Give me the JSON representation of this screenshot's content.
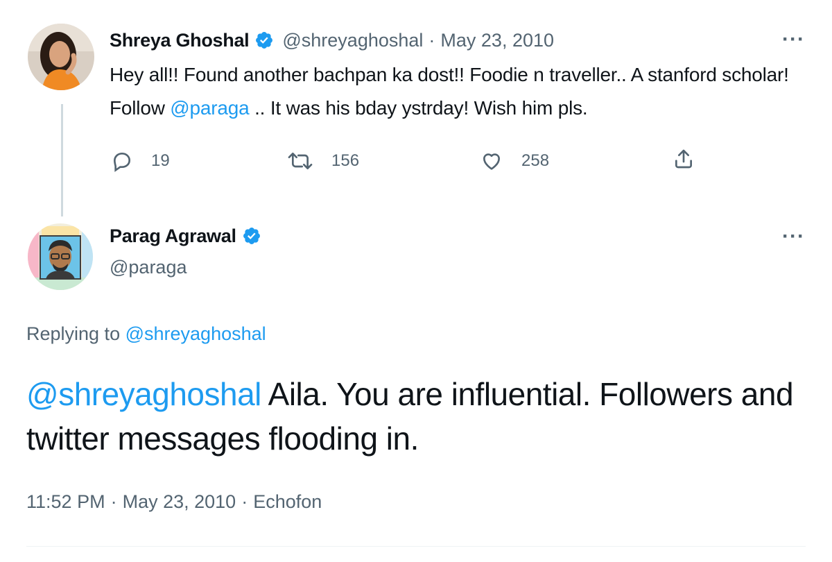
{
  "original_tweet": {
    "author_name": "Shreya Ghoshal",
    "handle": "@shreyaghoshal",
    "separator": "·",
    "date": "May 23, 2010",
    "text_1": "Hey all!! Found another bachpan ka dost!! Foodie n traveller.. A stanford scholar! Follow ",
    "mention": "@paraga",
    "text_2": " .. It was his bday ystrday! Wish him pls.",
    "more_label": "···",
    "actions": {
      "reply_count": "19",
      "retweet_count": "156",
      "like_count": "258"
    }
  },
  "reply_tweet": {
    "author_name": "Parag Agrawal",
    "handle": "@paraga",
    "more_label": "···",
    "replying_to_label": "Replying to",
    "replying_to_handle": "@shreyaghoshal",
    "mention": "@shreyaghoshal",
    "text": " Aila. You are influential. Followers and twitter messages flooding in.",
    "time": "11:52 PM",
    "date": "May 23, 2010",
    "source": "Echofon",
    "separator": "·"
  },
  "colors": {
    "accent": "#1d9bf0",
    "muted": "#536471",
    "text": "#0f1419"
  }
}
